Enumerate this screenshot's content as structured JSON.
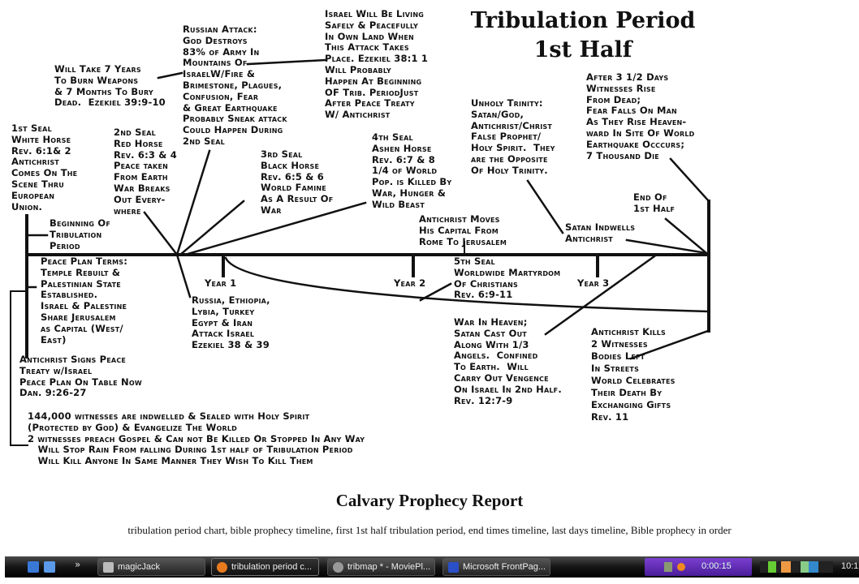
{
  "title": {
    "line1": "Tribulation Period",
    "line2": "1st Half"
  },
  "blocks": {
    "israel_living": [
      "Israel Will Be Living",
      "Safely & Peacefully",
      "In Own Land When",
      "This Attack Takes",
      "Place. Ezekiel 38:1 1",
      "Will Probably",
      "Happen At Beginning",
      "OF Trib. PeriodJust",
      "After Peace Treaty",
      "W/ Antichrist"
    ],
    "russian_attack": [
      "Russian Attack:",
      "God Destroys",
      "83% of Army In",
      "Mountains Of",
      "IsraelW/Fire &",
      "Brimestone, Plagues,",
      "Confusion, Fear",
      "& Great Earthquake",
      "Probably Sneak attack",
      "Could Happen During",
      "2nd Seal"
    ],
    "burn_weapons": [
      "Will Take 7 Years",
      "To Burn Weapons",
      "& 7 Months To Bury",
      "Dead.  Ezekiel 39:9-10"
    ],
    "seal1": [
      "1st Seal",
      "White Horse",
      "Rev. 6:1& 2",
      "Antichrist",
      "Comes On The",
      "Scene Thru",
      "European",
      "Union."
    ],
    "seal2": [
      "2nd Seal",
      "Red Horse",
      "Rev. 6:3 & 4",
      "Peace taken",
      "From Earth",
      "War Breaks",
      "Out Every-",
      "where"
    ],
    "seal3": [
      "3rd Seal",
      "Black Horse",
      "Rev. 6:5 & 6",
      "World Famine",
      "As A Result Of",
      "War"
    ],
    "seal4": [
      "4th Seal",
      "Ashen Horse",
      "Rev. 6:7 & 8",
      "1/4 of World",
      "Pop. is Killed By",
      "War, Hunger &",
      "Wild Beast"
    ],
    "capital": [
      "Antichrist Moves",
      "His Capital From",
      "Rome To Jerusalem"
    ],
    "unholy": [
      "Unholy Trinity:",
      "Satan/God,",
      "Antichrist/Christ",
      "False Prophet/",
      "Holy Spirit.  They",
      "are the Opposite",
      "Of Holy Trinity."
    ],
    "after_days": [
      "After 3 1/2 Days",
      "Witnesses Rise",
      "From Dead;",
      "Fear Falls On Man",
      "As They Rise Heaven-",
      "ward In Site Of World",
      "Earthquake Occcurs;",
      "7 Thousand Die"
    ],
    "end_half": [
      "End Of",
      "1st Half"
    ],
    "indwells": [
      "Satan Indwells",
      "Antichrist"
    ],
    "beginning": [
      "Beginning Of",
      "Tribulation",
      "Period"
    ],
    "peace_plan": [
      "Peace Plan Terms:",
      "Temple Rebuilt &",
      "Palestinian State",
      "Established.",
      "Israel & Palestine",
      "Share Jerusalem",
      "as Capital (West/",
      "East)"
    ],
    "russia": [
      "Russia, Ethiopia,",
      "Lybia, Turkey",
      "Egypt & Iran",
      "Attack Israel",
      "Ezekiel 38 & 39"
    ],
    "seal5": [
      "5th Seal",
      "Worldwide Martyrdom",
      "Of Christians",
      "Rev. 6:9-11"
    ],
    "signs": [
      "Antichrist Signs Peace",
      "Treaty w/Israel",
      "Peace Plan On Table Now",
      "Dan. 9:26-27"
    ],
    "war_heaven": [
      "War In Heaven;",
      "Satan Cast Out",
      "Along With 1/3",
      "Angels.  Confined",
      "To Earth.  Will",
      "Carry Out Vengence",
      "On Israel In 2nd Half.",
      "Rev. 12:7-9"
    ],
    "kills": [
      "Antichrist Kills",
      "2 Witnesses",
      "Bodies Left",
      "In Streets",
      "World Celebrates",
      "Their Death By",
      "Exchanging Gifts",
      "Rev. 11"
    ],
    "witnesses": [
      "144,000 witnesses are indwelled & Sealed with Holy Spirit",
      "(Protected by God) & Evangelize The World",
      "2 witnesses preach Gospel & Can not Be Killed Or Stopped In Any Way",
      "   Will Stop Rain From falling During 1st half of Tribulation Period",
      "   Will Kill Anyone In Same Manner They Wish To Kill Them"
    ]
  },
  "years": [
    "Year 1",
    "Year 2",
    "Year 3"
  ],
  "report_title": "Calvary Prophecy Report",
  "description": "tribulation period chart, bible prophecy timeline, first 1st half tribulation period, end times timeline, last days timeline, Bible prophecy in order",
  "taskbar": {
    "more": "»",
    "buttons": [
      {
        "label": "magicJack",
        "icon": "magicjack-icon",
        "active": false
      },
      {
        "label": "tribulation period c...",
        "icon": "firefox-icon",
        "active": true
      },
      {
        "label": "tribmap * - MoviePl...",
        "icon": "moviemaker-icon",
        "active": false
      },
      {
        "label": "Microsoft FrontPag...",
        "icon": "frontpage-icon",
        "active": false
      }
    ],
    "media_time": "0:00:15",
    "clock": "10:1"
  }
}
